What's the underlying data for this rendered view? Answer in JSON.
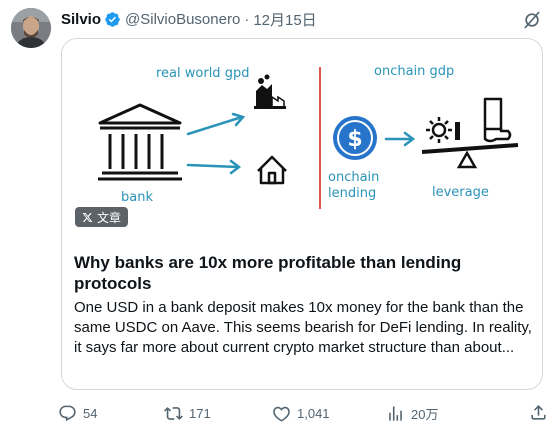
{
  "author": {
    "name": "Silvio",
    "handle": "@SilvioBusonero",
    "separator": "·",
    "date": "12月15日"
  },
  "media": {
    "labels": {
      "real_world": "real world gpd",
      "onchain_gdp": "onchain gdp",
      "bank": "bank",
      "onchain_lending_1": "onchain",
      "onchain_lending_2": "lending",
      "leverage": "leverage"
    },
    "accent_color": "#2a93b8",
    "divider_color": "#e0534f",
    "usdc_color": "#2775ca"
  },
  "article": {
    "badge": "文章",
    "title": "Why banks are 10x more profitable than lending protocols",
    "description": "One USD in a bank deposit makes 10x money for the bank than the same USDC on Aave. This seems bearish for DeFi lending. In reality, it says far more about current crypto market structure than about..."
  },
  "actions": {
    "replies": "54",
    "reposts": "171",
    "likes": "1,041",
    "views": "20万"
  },
  "icons": [
    "verified-badge-icon",
    "grok-icon",
    "x-logo-icon",
    "reply-icon",
    "repost-icon",
    "like-icon",
    "views-icon",
    "share-icon"
  ]
}
